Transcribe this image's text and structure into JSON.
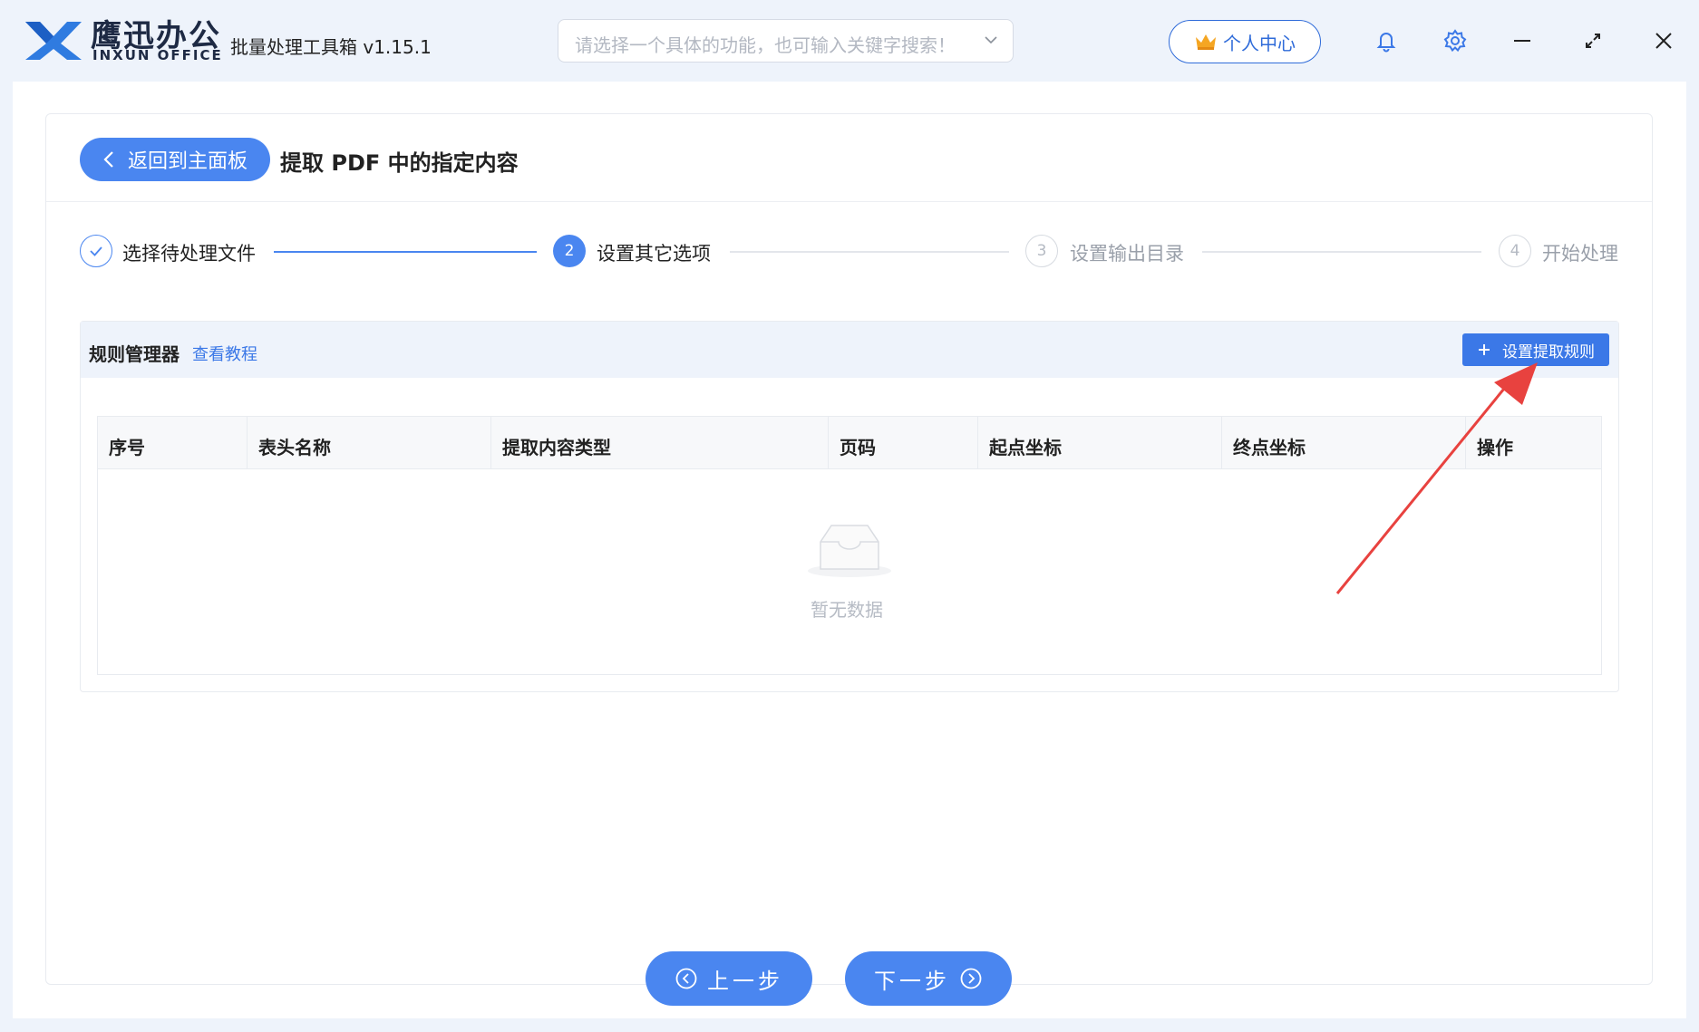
{
  "brand": {
    "name_cn": "鹰迅办公",
    "name_en": "INXUN OFFICE"
  },
  "app_title": "批量处理工具箱 v1.15.1",
  "search": {
    "placeholder": "请选择一个具体的功能，也可输入关键字搜索！"
  },
  "user_center": {
    "label": "个人中心"
  },
  "window_controls": [
    "bell-icon",
    "gear-icon",
    "minimize-icon",
    "maximize-icon",
    "close-icon"
  ],
  "header": {
    "back_label": "返回到主面板",
    "title": "提取 PDF 中的指定内容"
  },
  "steps": [
    {
      "index": "1",
      "label": "选择待处理文件",
      "state": "done"
    },
    {
      "index": "2",
      "label": "设置其它选项",
      "state": "active"
    },
    {
      "index": "3",
      "label": "设置输出目录",
      "state": "pending"
    },
    {
      "index": "4",
      "label": "开始处理",
      "state": "pending"
    }
  ],
  "rules": {
    "title": "规则管理器",
    "tutorial_link": "查看教程",
    "add_button": "设置提取规则",
    "columns": [
      "序号",
      "表头名称",
      "提取内容类型",
      "页码",
      "起点坐标",
      "终点坐标",
      "操作"
    ],
    "rows": [],
    "empty_text": "暂无数据"
  },
  "footer": {
    "prev_label": "上一步",
    "next_label": "下一步"
  },
  "colors": {
    "primary": "#4a86f0",
    "accent_blue": "#3b78e7",
    "annotation_red": "#e8423f"
  }
}
